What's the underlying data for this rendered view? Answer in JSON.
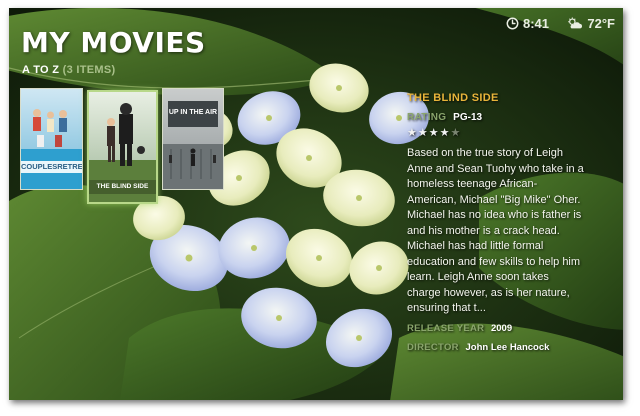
{
  "header": {
    "title": "MY MOVIES",
    "sort_label": "A TO Z",
    "item_count": "(3 ITEMS)"
  },
  "status": {
    "time": "8:41",
    "temperature": "72°F",
    "clock_icon": "clock-icon",
    "weather_icon": "partly-sunny-icon"
  },
  "posters": [
    {
      "title_line1": "COUPLES",
      "title_line2": "RETREAT",
      "selected": false
    },
    {
      "title": "THE BLIND SIDE",
      "selected": true
    },
    {
      "title": "UP IN THE AIR",
      "selected": false
    }
  ],
  "details": {
    "title": "THE BLIND SIDE",
    "rating_label": "RATING",
    "rating_value": "PG-13",
    "stars": {
      "filled": 4,
      "total": 5
    },
    "description": "Based on the true story of Leigh Anne and Sean Tuohy who take in a homeless teenage African-American, Michael \"Big Mike\" Oher. Michael has no idea who is father is and his mother is a crack head. Michael has had little formal education and few skills to help him learn. Leigh Anne soon takes charge however, as is her nature, ensuring that t...",
    "release_year_label": "RELEASE YEAR",
    "release_year_value": "2009",
    "director_label": "DIRECTOR",
    "director_value": "John Lee Hancock"
  },
  "colors": {
    "accent_title": "#e8b43a",
    "label_green": "#8aa56c",
    "selection_glow": "#b8d889"
  }
}
